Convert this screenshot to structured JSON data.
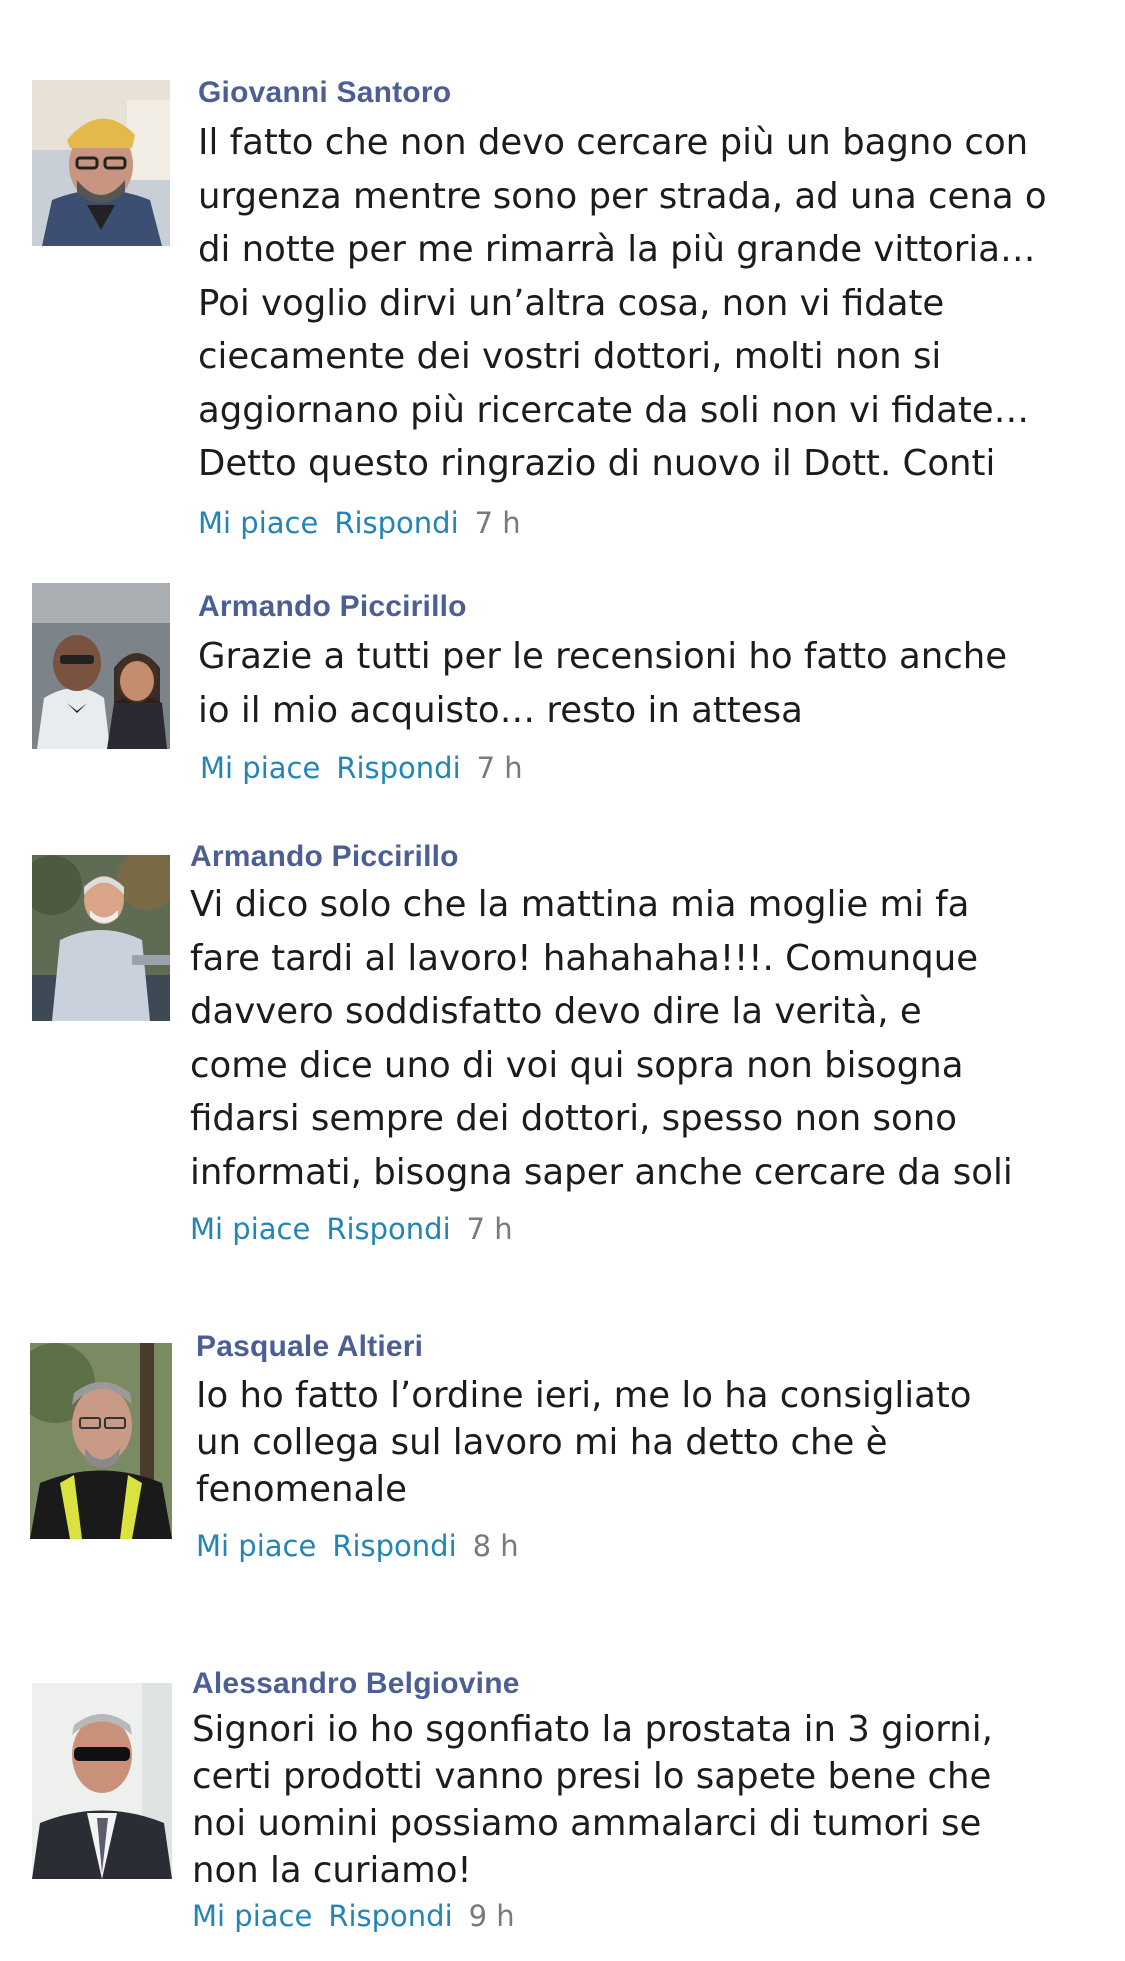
{
  "comments": [
    {
      "author": "Giovanni Santoro",
      "text": "Il fatto che non devo cercare più un bagno con\nurgenza mentre sono per strada, ad una cena o\ndi notte per me rimarrà la più grande vittoria…\nPoi voglio dirvi un’altra cosa, non vi fidate\nciecamente dei vostri dottori, molti non si\naggiornano più ricercate da soli non vi fidate…\nDetto questo ringrazio di nuovo il Dott. Conti",
      "like_label": "Mi piace",
      "reply_label": "Rispondi",
      "time": "7 h"
    },
    {
      "author": "Armando Piccirillo",
      "text": "Grazie a tutti per le recensioni ho fatto anche\nio il mio acquisto… resto in attesa",
      "like_label": "Mi piace",
      "reply_label": "Rispondi",
      "time": "7 h"
    },
    {
      "author": "Armando Piccirillo",
      "text": "Vi dico solo che la mattina mia moglie mi fa\nfare tardi al lavoro! hahahaha!!!. Comunque\ndavvero soddisfatto devo dire la verità, e\ncome dice uno di voi qui sopra non bisogna\nfidarsi sempre dei dottori, spesso non sono\ninformati, bisogna saper anche cercare da soli",
      "like_label": "Mi piace",
      "reply_label": "Rispondi",
      "time": "7 h"
    },
    {
      "author": "Pasquale Altieri",
      "text": "Io ho fatto l’ordine ieri, me lo ha consigliato\nun collega sul lavoro mi ha detto che è\nfenomenale",
      "like_label": "Mi piace",
      "reply_label": "Rispondi",
      "time": "8 h"
    },
    {
      "author": "Alessandro Belgiovine",
      "text": "Signori io ho sgonfiato la prostata in 3 giorni,\ncerti prodotti vanno presi lo sapete bene che\nnoi uomini possiamo ammalarci di tumori se\nnon la curiamo!",
      "like_label": "Mi piace",
      "reply_label": "Rispondi",
      "time": "9 h"
    }
  ]
}
